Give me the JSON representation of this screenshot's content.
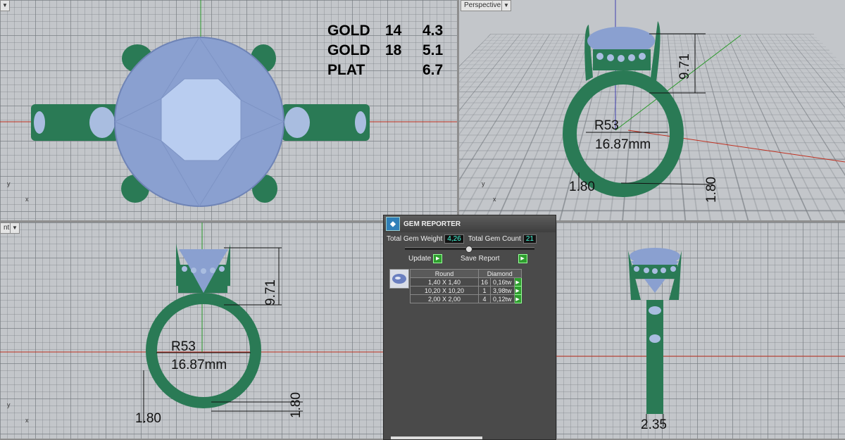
{
  "viewports": {
    "top": {
      "axis_x": "x",
      "axis_y": "y"
    },
    "perspective": {
      "label": "Perspective",
      "axis_x": "x",
      "axis_y": "y"
    },
    "front": {
      "label": "nt",
      "axis_x": "x",
      "axis_y": "y"
    }
  },
  "weights_annotation": [
    {
      "metal": "GOLD",
      "karat": "14",
      "weight": "4.3"
    },
    {
      "metal": "GOLD",
      "karat": "18",
      "weight": "5.1"
    },
    {
      "metal": "PLAT",
      "karat": "",
      "weight": "6.7"
    }
  ],
  "dimensions": {
    "radius": "R53",
    "diameter": "16.87mm",
    "height": "9.71",
    "band_width": "1.80",
    "band_thickness": "1.80",
    "side_width": "2.35"
  },
  "gem_reporter": {
    "title": "GEM REPORTER",
    "total_weight_label": "Total Gem Weight",
    "total_weight_value": "4,26",
    "total_count_label": "Total Gem Count",
    "total_count_value": "21",
    "update_label": "Update",
    "save_label": "Save Report",
    "header_shape": "Round",
    "header_type": "Diamond",
    "rows": [
      {
        "size": "1,40 X 1,40",
        "count": "16",
        "weight": "0,16tw"
      },
      {
        "size": "10,20 X 10,20",
        "count": "1",
        "weight": "3,98tw"
      },
      {
        "size": "2,00 X 2,00",
        "count": "4",
        "weight": "0,12tw"
      }
    ]
  },
  "colors": {
    "metal": "#2a7a55",
    "gem": "#8fa6d6",
    "viewport_bg": "#c3c6ca",
    "panel_bg": "#4a4a4a"
  }
}
